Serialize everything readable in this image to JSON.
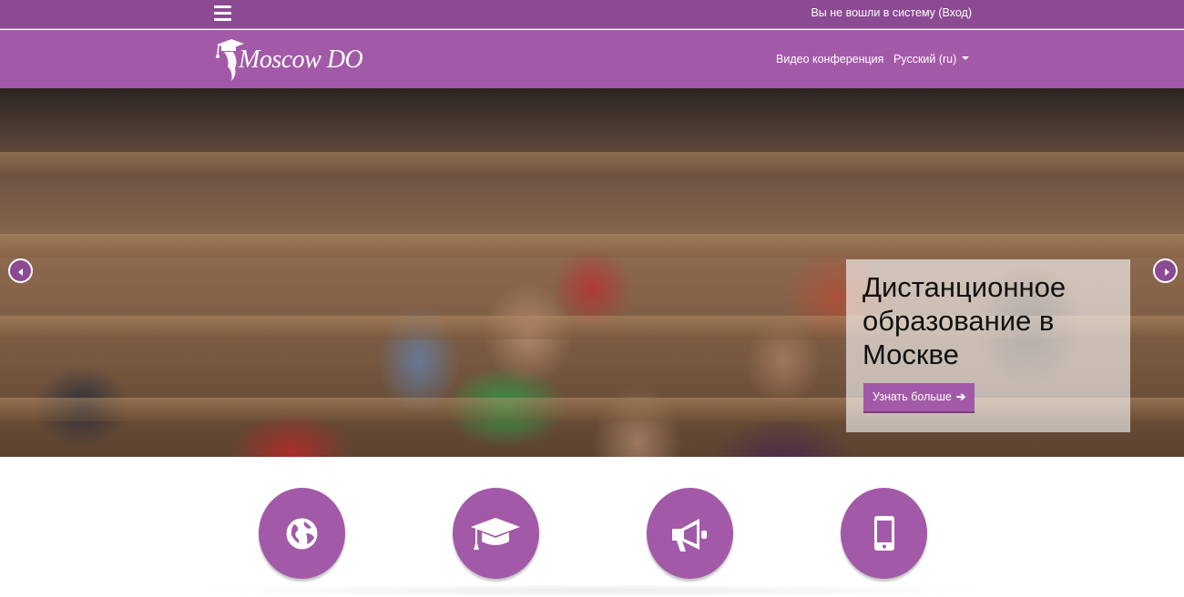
{
  "topbar": {
    "menu_icon": "hamburger-icon",
    "login_text": "Вы не вошли в систему (Вход)"
  },
  "navbar": {
    "logo_text": "Moscow DO",
    "logo_icon": "graduate-cap-icon",
    "links": [
      {
        "label": "Видео конференция"
      },
      {
        "label": "Русский (ru)",
        "icon": "caret-down-icon"
      }
    ]
  },
  "carousel": {
    "prev_icon": "chevron-left-icon",
    "next_icon": "chevron-right-icon",
    "caption": {
      "title": "Дистанционное образование в Москве",
      "button_label": "Узнать больше",
      "button_icon": "arrow-right-icon"
    }
  },
  "features": [
    {
      "icon": "globe-icon"
    },
    {
      "icon": "graduation-cap-icon"
    },
    {
      "icon": "megaphone-icon"
    },
    {
      "icon": "mobile-phone-icon"
    }
  ],
  "colors": {
    "topbar": "#8b4a91",
    "navbar": "#a25aa8",
    "accent": "#a25aa8",
    "text_light": "#ffffff"
  }
}
